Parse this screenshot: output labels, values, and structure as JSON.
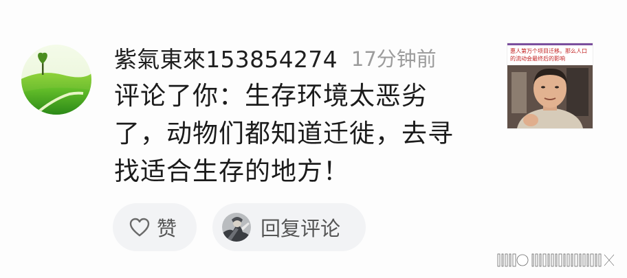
{
  "comment": {
    "username": "紫氣東來153854274",
    "timestamp": "17分钟前",
    "text_lines": [
      "评论了你：生存环境太恶劣",
      "了，动物们都知道迁徙，去寻",
      "找适合生存的地方！"
    ]
  },
  "thumbnail": {
    "headline": "惠人第万个项目迁移。那么人口的流动会最终后的影响"
  },
  "actions": {
    "like_label": "赞",
    "reply_label": "回复评论"
  },
  "icons": {
    "avatar": "green-hills-tree-avatar",
    "like": "heart-icon",
    "reply_avatar": "mini-avatar"
  },
  "colors": {
    "timestamp": "#9c9c9c",
    "pill_background": "#f2f3f5",
    "text": "#1b1b1b"
  }
}
